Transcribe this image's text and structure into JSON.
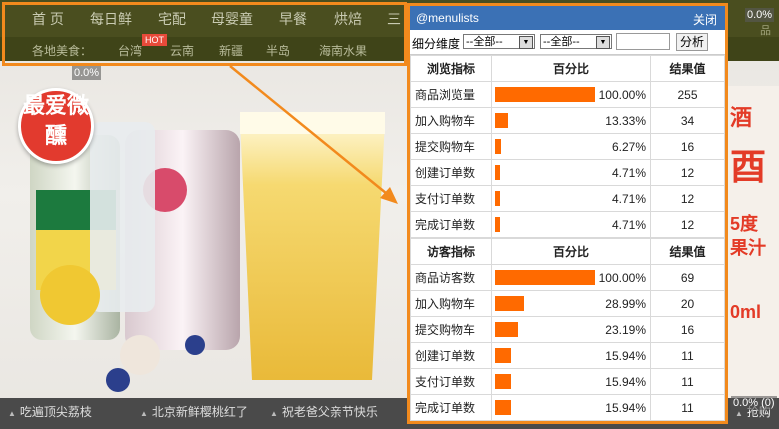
{
  "site": {
    "nav": [
      "首 页",
      "每日鲜",
      "宅配",
      "母婴童",
      "早餐",
      "烘焙",
      "三"
    ],
    "subnav_label": "各地美食：",
    "subnav": [
      "台湾",
      "云南",
      "新疆",
      "半岛",
      "海南水果"
    ],
    "hot_badge": "HOT",
    "right_small": "品",
    "overlay_pct_top_right": "0.0%",
    "overlay_pct_left": "0.0%",
    "overlay_pct_bottom_right": "0.0% (0)",
    "badge_text": "最爱微醺",
    "right_ad": [
      "酒",
      "酉",
      "5度",
      "果汁",
      "0ml"
    ],
    "captions": [
      "吃遍顶尖荔枝",
      "北京新鲜樱桃红了",
      "祝老爸父亲节快乐"
    ],
    "caption_right": "抢购",
    "accent_colors": {
      "nav": "#4a4e1f",
      "highlight": "#f28a1d",
      "panel_header": "#3b71b5",
      "bar": "#ff6a00"
    }
  },
  "panel": {
    "title": "@menulists",
    "close_label": "关闭",
    "filter_label": "细分维度",
    "select1": "--全部--",
    "select2": "--全部--",
    "analyze_label": "分析",
    "browse": {
      "header": [
        "浏览指标",
        "百分比",
        "结果值"
      ],
      "rows": [
        {
          "name": "商品浏览量",
          "pct": 100.0,
          "pct_text": "100.00%",
          "value": "255"
        },
        {
          "name": "加入购物车",
          "pct": 13.33,
          "pct_text": "13.33%",
          "value": "34"
        },
        {
          "name": "提交购物车",
          "pct": 6.27,
          "pct_text": "6.27%",
          "value": "16"
        },
        {
          "name": "创建订单数",
          "pct": 4.71,
          "pct_text": "4.71%",
          "value": "12"
        },
        {
          "name": "支付订单数",
          "pct": 4.71,
          "pct_text": "4.71%",
          "value": "12"
        },
        {
          "name": "完成订单数",
          "pct": 4.71,
          "pct_text": "4.71%",
          "value": "12"
        }
      ]
    },
    "visitor": {
      "header": [
        "访客指标",
        "百分比",
        "结果值"
      ],
      "rows": [
        {
          "name": "商品访客数",
          "pct": 100.0,
          "pct_text": "100.00%",
          "value": "69"
        },
        {
          "name": "加入购物车",
          "pct": 28.99,
          "pct_text": "28.99%",
          "value": "20"
        },
        {
          "name": "提交购物车",
          "pct": 23.19,
          "pct_text": "23.19%",
          "value": "16"
        },
        {
          "name": "创建订单数",
          "pct": 15.94,
          "pct_text": "15.94%",
          "value": "11"
        },
        {
          "name": "支付订单数",
          "pct": 15.94,
          "pct_text": "15.94%",
          "value": "11"
        },
        {
          "name": "完成订单数",
          "pct": 15.94,
          "pct_text": "15.94%",
          "value": "11"
        }
      ]
    }
  }
}
